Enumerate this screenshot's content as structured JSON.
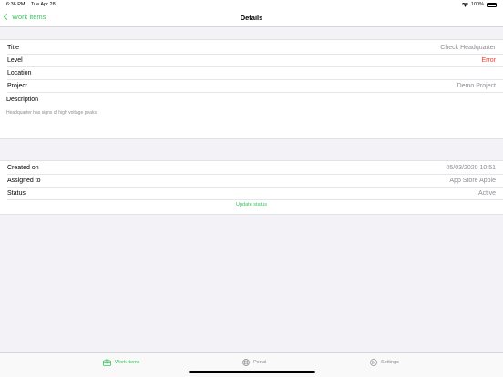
{
  "status_bar": {
    "time": "6:36 PM",
    "date": "Tue Apr 28",
    "battery": "100%"
  },
  "nav": {
    "back_label": "Work items",
    "title": "Details"
  },
  "details": {
    "rows": [
      {
        "label": "Title",
        "value": "Check Headquarter"
      },
      {
        "label": "Level",
        "value": "Error"
      },
      {
        "label": "Location",
        "value": ""
      },
      {
        "label": "Project",
        "value": "Demo Project"
      }
    ],
    "description_label": "Description",
    "description_text": "Headquarter has signs of high voltage peaks"
  },
  "meta": {
    "rows": [
      {
        "label": "Created on",
        "value": "05/03/2020 10:51"
      },
      {
        "label": "Assigned to",
        "value": "App Store Apple"
      },
      {
        "label": "Status",
        "value": "Active"
      }
    ],
    "update_label": "Update status"
  },
  "tabs": [
    {
      "label": "Work items",
      "icon": "toolbox-icon",
      "active": true
    },
    {
      "label": "Portal",
      "icon": "globe-icon",
      "active": false
    },
    {
      "label": "Settings",
      "icon": "gear-icon",
      "active": false
    }
  ],
  "colors": {
    "accent": "#34c759",
    "error": "#ff3b30",
    "secondary_text": "#8e8e93",
    "background": "#f2f2f7"
  }
}
